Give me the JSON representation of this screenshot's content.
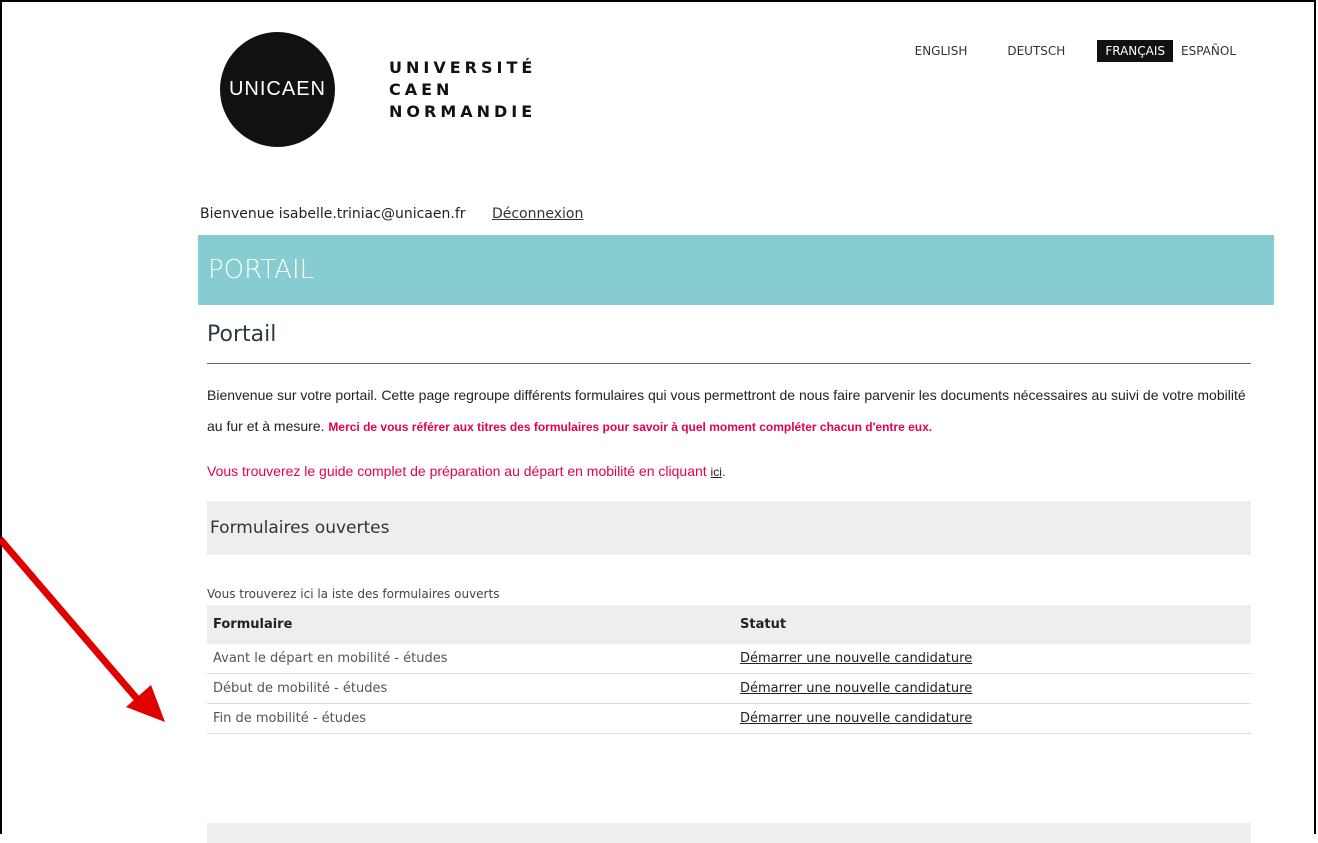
{
  "header": {
    "logo_mark": "UNICAEN",
    "logo_lines": [
      "UNIVERSITÉ",
      "CAEN",
      "NORMANDIE"
    ],
    "languages": [
      "ENGLISH",
      "DEUTSCH",
      "FRANÇAIS",
      "ESPAÑOL"
    ],
    "active_language": "FRANÇAIS"
  },
  "user": {
    "welcome": "Bienvenue isabelle.triniac@unicaen.fr",
    "logout_label": "Déconnexion"
  },
  "banner": {
    "title": "PORTAIL"
  },
  "main": {
    "title": "Portail",
    "intro_text": "Bienvenue sur votre portail. Cette page regroupe différents formulaires qui vous permettront de nous faire parvenir les documents nécessaires au suivi de votre mobilité au fur et à mesure. ",
    "intro_highlight": "Merci de vous référer aux titres des formulaires pour savoir à quel moment compléter chacun d'entre eux.",
    "guide_text": "Vous trouverez le guide complet de préparation au départ en mobilité en cliquant ",
    "guide_link": "ici",
    "guide_end": "."
  },
  "forms_section": {
    "title": "Formulaires ouvertes",
    "caption": "Vous trouverez ici la iste des formulaires ouverts",
    "columns": [
      "Formulaire",
      "Statut"
    ],
    "rows": [
      {
        "formulaire": "Avant le départ en mobilité - études",
        "statut": "Démarrer une nouvelle candidature"
      },
      {
        "formulaire": "Début de mobilité - études",
        "statut": "Démarrer une nouvelle candidature"
      },
      {
        "formulaire": "Fin de mobilité - études",
        "statut": "Démarrer une nouvelle candidature"
      }
    ]
  },
  "colors": {
    "banner": "#86ccd1",
    "highlight": "#e5004f",
    "arrow": "#e00000"
  }
}
